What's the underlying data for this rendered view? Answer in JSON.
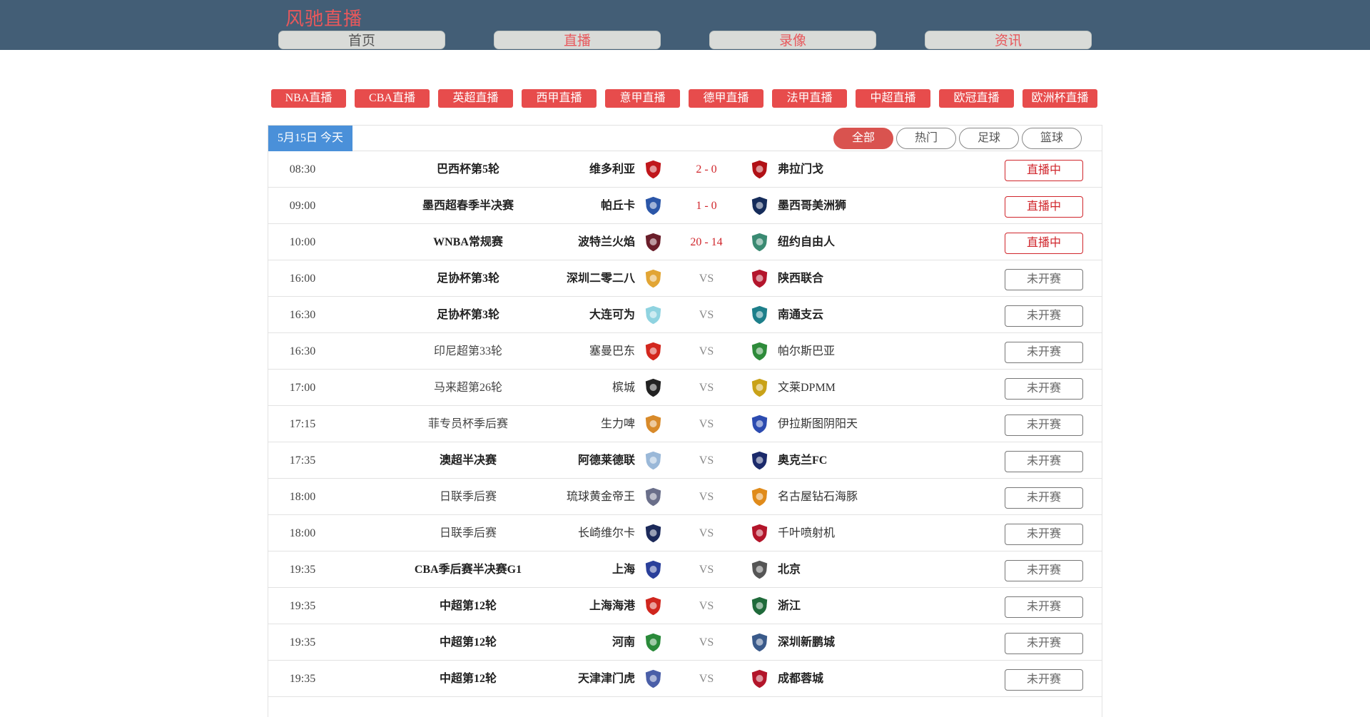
{
  "site": {
    "title": "风驰直播"
  },
  "nav": [
    {
      "label": "首页",
      "name": "nav-home"
    },
    {
      "label": "直播",
      "name": "nav-live"
    },
    {
      "label": "录像",
      "name": "nav-replay"
    },
    {
      "label": "资讯",
      "name": "nav-news"
    }
  ],
  "leagues": [
    "NBA直播",
    "CBA直播",
    "英超直播",
    "西甲直播",
    "意甲直播",
    "德甲直播",
    "法甲直播",
    "中超直播",
    "欧冠直播",
    "欧洲杯直播"
  ],
  "date_tab": "5月15日 今天",
  "filters": [
    {
      "label": "全部",
      "active": true
    },
    {
      "label": "热门",
      "active": false
    },
    {
      "label": "足球",
      "active": false
    },
    {
      "label": "篮球",
      "active": false
    }
  ],
  "colors": {
    "header_bg": "#435e76",
    "accent_red": "#e74c4c",
    "date_tab_blue": "#4a90d9",
    "live_red": "#d0262c"
  },
  "matches": [
    {
      "time": "08:30",
      "league": "巴西杯第5轮",
      "hot": true,
      "home": "维多利亚",
      "away": "弗拉门戈",
      "score": "2 - 0",
      "live": true,
      "status": "直播中",
      "home_icon": "vitoria-crest-icon",
      "away_icon": "flamengo-crest-icon",
      "hc": "#c0161b",
      "ac": "#b11116"
    },
    {
      "time": "09:00",
      "league": "墨西超春季半决赛",
      "hot": true,
      "home": "帕丘卡",
      "away": "墨西哥美洲狮",
      "score": "1 - 0",
      "live": true,
      "status": "直播中",
      "home_icon": "pachuca-crest-icon",
      "away_icon": "pumas-crest-icon",
      "hc": "#2b56a8",
      "ac": "#152c5a"
    },
    {
      "time": "10:00",
      "league": "WNBA常规赛",
      "hot": true,
      "home": "波特兰火焰",
      "away": "纽约自由人",
      "score": "20 - 14",
      "live": true,
      "status": "直播中",
      "home_icon": "portland-fire-icon",
      "away_icon": "ny-liberty-icon",
      "hc": "#6a1e2a",
      "ac": "#3a8a72"
    },
    {
      "time": "16:00",
      "league": "足协杯第3轮",
      "hot": true,
      "home": "深圳二零二八",
      "away": "陕西联合",
      "score": "VS",
      "live": false,
      "status": "未开赛",
      "home_icon": "shenzhen-2028-icon",
      "away_icon": "shaanxi-united-icon",
      "hc": "#e2a534",
      "ac": "#b4152c"
    },
    {
      "time": "16:30",
      "league": "足协杯第3轮",
      "hot": true,
      "home": "大连可为",
      "away": "南通支云",
      "score": "VS",
      "live": false,
      "status": "未开赛",
      "home_icon": "dalian-kewei-icon",
      "away_icon": "nantong-zhiyun-icon",
      "hc": "#8fd3e0",
      "ac": "#1d7f8a"
    },
    {
      "time": "16:30",
      "league": "印尼超第33轮",
      "hot": false,
      "home": "塞曼巴东",
      "away": "帕尔斯巴亚",
      "score": "VS",
      "live": false,
      "status": "未开赛",
      "home_icon": "semen-padang-icon",
      "away_icon": "persebaya-icon",
      "hc": "#d3271e",
      "ac": "#2e8b3a"
    },
    {
      "time": "17:00",
      "league": "马来超第26轮",
      "hot": false,
      "home": "槟城",
      "away": "文莱DPMM",
      "score": "VS",
      "live": false,
      "status": "未开赛",
      "home_icon": "penang-icon",
      "away_icon": "dpmm-icon",
      "hc": "#222222",
      "ac": "#c9a218"
    },
    {
      "time": "17:15",
      "league": "菲专员杯季后赛",
      "hot": false,
      "home": "生力啤",
      "away": "伊拉斯图阴阳天",
      "score": "VS",
      "live": false,
      "status": "未开赛",
      "home_icon": "san-miguel-icon",
      "away_icon": "rain-or-shine-icon",
      "hc": "#d88a2a",
      "ac": "#2c4bb0"
    },
    {
      "time": "17:35",
      "league": "澳超半决赛",
      "hot": true,
      "home": "阿德莱德联",
      "away": "奥克兰FC",
      "score": "VS",
      "live": false,
      "status": "未开赛",
      "home_icon": "adelaide-united-icon",
      "away_icon": "auckland-fc-icon",
      "hc": "#9ab8d8",
      "ac": "#1b2a6b"
    },
    {
      "time": "18:00",
      "league": "日联季后赛",
      "hot": false,
      "home": "琉球黄金帝王",
      "away": "名古屋钻石海豚",
      "score": "VS",
      "live": false,
      "status": "未开赛",
      "home_icon": "ryukyu-icon",
      "away_icon": "nagoya-dolphins-icon",
      "hc": "#6a6f8a",
      "ac": "#e08b1a"
    },
    {
      "time": "18:00",
      "league": "日联季后赛",
      "hot": false,
      "home": "长崎维尔卡",
      "away": "千叶喷射机",
      "score": "VS",
      "live": false,
      "status": "未开赛",
      "home_icon": "nagasaki-velca-icon",
      "away_icon": "chiba-jets-icon",
      "hc": "#1c2a5a",
      "ac": "#b3152a"
    },
    {
      "time": "19:35",
      "league": "CBA季后赛半决赛G1",
      "hot": true,
      "home": "上海",
      "away": "北京",
      "score": "VS",
      "live": false,
      "status": "未开赛",
      "home_icon": "shanghai-sharks-icon",
      "away_icon": "beijing-ducks-icon",
      "hc": "#2a3f9a",
      "ac": "#555555"
    },
    {
      "time": "19:35",
      "league": "中超第12轮",
      "hot": true,
      "home": "上海海港",
      "away": "浙江",
      "score": "VS",
      "live": false,
      "status": "未开赛",
      "home_icon": "shanghai-port-icon",
      "away_icon": "zhejiang-fc-icon",
      "hc": "#d0261e",
      "ac": "#1f6a3a"
    },
    {
      "time": "19:35",
      "league": "中超第12轮",
      "hot": true,
      "home": "河南",
      "away": "深圳新鹏城",
      "score": "VS",
      "live": false,
      "status": "未开赛",
      "home_icon": "henan-fc-icon",
      "away_icon": "shenzhen-peng-city-icon",
      "hc": "#2a8a3a",
      "ac": "#3a5a8a"
    },
    {
      "time": "19:35",
      "league": "中超第12轮",
      "hot": true,
      "home": "天津津门虎",
      "away": "成都蓉城",
      "score": "VS",
      "live": false,
      "status": "未开赛",
      "home_icon": "tianjin-tigers-icon",
      "away_icon": "chengdu-rongcheng-icon",
      "hc": "#4a5fa8",
      "ac": "#b3152a"
    }
  ]
}
